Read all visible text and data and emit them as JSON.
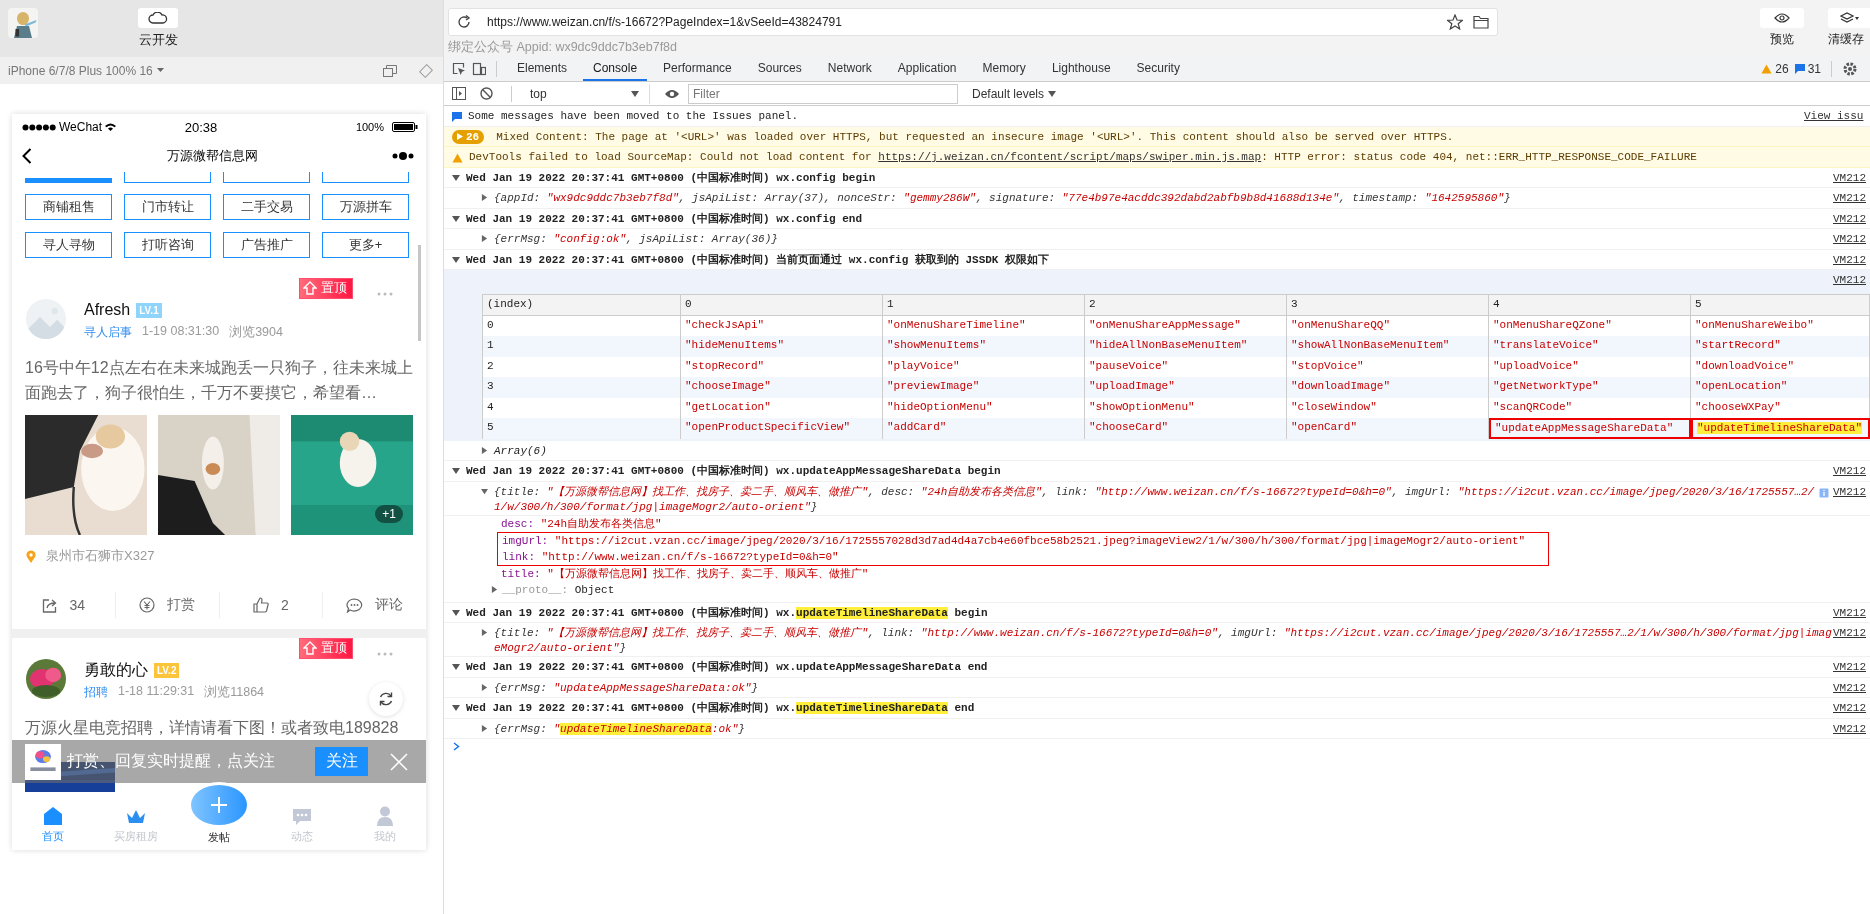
{
  "toolbar": {
    "cloud_button": "云开发",
    "preview_button": "预览",
    "clear_cache_button": "清缓存"
  },
  "address_bar": {
    "url": "https://www.weizan.cn/f/s-16672?PageIndex=1&vSeeId=43824791",
    "appid_label": "绑定公众号 Appid: wx9dc9ddc7b3eb7f8d"
  },
  "simulator": {
    "device": "iPhone 6/7/8 Plus 100% 16",
    "status_bar": {
      "carrier": "WeChat",
      "time": "20:38",
      "battery": "100%"
    },
    "nav_title": "万源微帮信息网",
    "categories": [
      "商铺租售",
      "门市转让",
      "二手交易",
      "万源拼车",
      "寻人寻物",
      "打听咨询",
      "广告推广",
      "更多+"
    ],
    "posts": [
      {
        "author": "Afresh",
        "level": {
          "text": "LV.1",
          "color": "#8fd4fb"
        },
        "category": "寻人启事",
        "time": "1-19 08:31:30",
        "views": "浏览3904",
        "pinned": "置顶",
        "text": "16号中午12点左右在未来城跑丢一只狗子，往未来城上面跑去了，狗子很怕生，千万不要摸它，希望看…",
        "more_images": "+1",
        "location": "泉州市石狮市X327",
        "actions": [
          {
            "kind": "share",
            "label": "34"
          },
          {
            "kind": "reward",
            "label": "打赏"
          },
          {
            "kind": "like",
            "label": "2"
          },
          {
            "kind": "comment",
            "label": "评论"
          }
        ]
      },
      {
        "author": "勇敢的心",
        "level": {
          "text": "LV.2",
          "color": "#fbc43a"
        },
        "category": "招聘",
        "time": "1-18 11:29:31",
        "views": "浏览11864",
        "pinned": "置顶",
        "text": "万源火星电竞招聘，详情请看下图！或者致电189828"
      }
    ],
    "follow_banner": {
      "text": "打赏、回复实时提醒，点关注",
      "button": "关注"
    },
    "tab_bar": [
      {
        "kind": "home",
        "label": "首页",
        "selected": true
      },
      {
        "kind": "crown",
        "label": "买房租房",
        "selected": false
      },
      {
        "kind": "post",
        "label": "发帖",
        "selected": false
      },
      {
        "kind": "chat",
        "label": "动态",
        "selected": false
      },
      {
        "kind": "user",
        "label": "我的",
        "selected": false
      }
    ]
  },
  "devtools": {
    "tabs": [
      {
        "label": "Elements",
        "selected": false
      },
      {
        "label": "Console",
        "selected": true
      },
      {
        "label": "Performance",
        "selected": false
      },
      {
        "label": "Sources",
        "selected": false
      },
      {
        "label": "Network",
        "selected": false
      },
      {
        "label": "Application",
        "selected": false
      },
      {
        "label": "Memory",
        "selected": false
      },
      {
        "label": "Lighthouse",
        "selected": false
      },
      {
        "label": "Security",
        "selected": false
      }
    ],
    "warning_count": "26",
    "message_count": "31",
    "context": "top",
    "filter_placeholder": "Filter",
    "levels": "Default levels",
    "console": [
      {
        "kind": "info",
        "text": "Some messages have been moved to the Issues panel.",
        "link": "View issu"
      },
      {
        "kind": "warning-group",
        "count": "26",
        "text": "Mixed Content: The page at '<URL>' was loaded over HTTPS, but requested an insecure image '<URL>'. This content should also be served over HTTPS."
      },
      {
        "kind": "warning",
        "text": "DevTools failed to load SourceMap: Could not load content for ",
        "link": "https://j.weizan.cn/fcontent/script/maps/swiper.min.js.map",
        "after": ": HTTP error: status code 404, net::ERR_HTTP_RESPONSE_CODE_FAILURE"
      },
      {
        "kind": "group",
        "expanded": true,
        "source": "VM212",
        "tokens": [
          {
            "text": "Wed Jan 19 2022 20:37:41 GMT+0800 (中国标准时间) wx.config begin",
            "kind": "plain"
          }
        ]
      },
      {
        "kind": "object",
        "expanded": false,
        "source": "VM212",
        "tokens": [
          {
            "text": "{appId: ",
            "kind": "key"
          },
          {
            "text": "\"wx9dc9ddc7b3eb7f8d\"",
            "kind": "string"
          },
          {
            "text": ", jsApiList: Array(37), nonceStr: ",
            "kind": "key"
          },
          {
            "text": "\"gemmy286W\"",
            "kind": "string"
          },
          {
            "text": ", signature: ",
            "kind": "key"
          },
          {
            "text": "\"77e4b97e4acddc392dabd2abfb9b8d41688d134e\"",
            "kind": "string"
          },
          {
            "text": ", timestamp: ",
            "kind": "key"
          },
          {
            "text": "\"1642595860\"",
            "kind": "string"
          },
          {
            "text": "}",
            "kind": "key"
          }
        ]
      },
      {
        "kind": "group",
        "expanded": true,
        "source": "VM212",
        "tokens": [
          {
            "text": "Wed Jan 19 2022 20:37:41 GMT+0800 (中国标准时间) wx.config end",
            "kind": "plain"
          }
        ]
      },
      {
        "kind": "object",
        "expanded": false,
        "source": "VM212",
        "tokens": [
          {
            "text": "{errMsg: ",
            "kind": "key"
          },
          {
            "text": "\"config:ok\"",
            "kind": "string"
          },
          {
            "text": ", jsApiList: Array(36)}",
            "kind": "key"
          }
        ]
      },
      {
        "kind": "group",
        "expanded": true,
        "source": "VM212",
        "tokens": [
          {
            "text": "Wed Jan 19 2022 20:37:41 GMT+0800 (中国标准时间) 当前页面通过 wx.config 获取到的 JSSDK 权限如下",
            "kind": "plain"
          }
        ]
      },
      {
        "kind": "table",
        "source": "VM212",
        "columns": [
          "(index)",
          "0",
          "1",
          "2",
          "3",
          "4",
          "5"
        ],
        "rows": [
          {
            "cells": [
              {
                "text": "0",
                "boxed": false,
                "highlighted": false
              },
              {
                "text": "\"checkJsApi\"",
                "boxed": false,
                "highlighted": false
              },
              {
                "text": "\"onMenuShareTimeline\"",
                "boxed": false,
                "highlighted": false
              },
              {
                "text": "\"onMenuShareAppMessage\"",
                "boxed": false,
                "highlighted": false
              },
              {
                "text": "\"onMenuShareQQ\"",
                "boxed": false,
                "highlighted": false
              },
              {
                "text": "\"onMenuShareQZone\"",
                "boxed": false,
                "highlighted": false
              },
              {
                "text": "\"onMenuShareWeibo\"",
                "boxed": false,
                "highlighted": false
              }
            ]
          },
          {
            "cells": [
              {
                "text": "1",
                "boxed": false,
                "highlighted": false
              },
              {
                "text": "\"hideMenuItems\"",
                "boxed": false,
                "highlighted": false
              },
              {
                "text": "\"showMenuItems\"",
                "boxed": false,
                "highlighted": false
              },
              {
                "text": "\"hideAllNonBaseMenuItem\"",
                "boxed": false,
                "highlighted": false
              },
              {
                "text": "\"showAllNonBaseMenuItem\"",
                "boxed": false,
                "highlighted": false
              },
              {
                "text": "\"translateVoice\"",
                "boxed": false,
                "highlighted": false
              },
              {
                "text": "\"startRecord\"",
                "boxed": false,
                "highlighted": false
              }
            ]
          },
          {
            "cells": [
              {
                "text": "2",
                "boxed": false,
                "highlighted": false
              },
              {
                "text": "\"stopRecord\"",
                "boxed": false,
                "highlighted": false
              },
              {
                "text": "\"playVoice\"",
                "boxed": false,
                "highlighted": false
              },
              {
                "text": "\"pauseVoice\"",
                "boxed": false,
                "highlighted": false
              },
              {
                "text": "\"stopVoice\"",
                "boxed": false,
                "highlighted": false
              },
              {
                "text": "\"uploadVoice\"",
                "boxed": false,
                "highlighted": false
              },
              {
                "text": "\"downloadVoice\"",
                "boxed": false,
                "highlighted": false
              }
            ]
          },
          {
            "cells": [
              {
                "text": "3",
                "boxed": false,
                "highlighted": false
              },
              {
                "text": "\"chooseImage\"",
                "boxed": false,
                "highlighted": false
              },
              {
                "text": "\"previewImage\"",
                "boxed": false,
                "highlighted": false
              },
              {
                "text": "\"uploadImage\"",
                "boxed": false,
                "highlighted": false
              },
              {
                "text": "\"downloadImage\"",
                "boxed": false,
                "highlighted": false
              },
              {
                "text": "\"getNetworkType\"",
                "boxed": false,
                "highlighted": false
              },
              {
                "text": "\"openLocation\"",
                "boxed": false,
                "highlighted": false
              }
            ]
          },
          {
            "cells": [
              {
                "text": "4",
                "boxed": false,
                "highlighted": false
              },
              {
                "text": "\"getLocation\"",
                "boxed": false,
                "highlighted": false
              },
              {
                "text": "\"hideOptionMenu\"",
                "boxed": false,
                "highlighted": false
              },
              {
                "text": "\"showOptionMenu\"",
                "boxed": false,
                "highlighted": false
              },
              {
                "text": "\"closeWindow\"",
                "boxed": false,
                "highlighted": false
              },
              {
                "text": "\"scanQRCode\"",
                "boxed": false,
                "highlighted": false
              },
              {
                "text": "\"chooseWXPay\"",
                "boxed": false,
                "highlighted": false
              }
            ]
          },
          {
            "cells": [
              {
                "text": "5",
                "boxed": false,
                "highlighted": false
              },
              {
                "text": "\"openProductSpecificView\"",
                "boxed": false,
                "highlighted": false
              },
              {
                "text": "\"addCard\"",
                "boxed": false,
                "highlighted": false
              },
              {
                "text": "\"chooseCard\"",
                "boxed": false,
                "highlighted": false
              },
              {
                "text": "\"openCard\"",
                "boxed": false,
                "highlighted": false
              },
              {
                "text": "\"updateAppMessageShareData\"",
                "boxed": true,
                "highlighted": false
              },
              {
                "text": "\"updateTimelineShareData\"",
                "boxed": true,
                "highlighted": true
              }
            ]
          }
        ]
      },
      {
        "kind": "object",
        "expanded": false,
        "tokens": [
          {
            "text": "Array(6)",
            "kind": "plain"
          }
        ]
      },
      {
        "kind": "group",
        "expanded": true,
        "source": "VM212",
        "tokens": [
          {
            "text": "Wed Jan 19 2022 20:37:41 GMT+0800 (中国标准时间) wx.updateAppMessageShareData begin",
            "kind": "plain"
          }
        ]
      },
      {
        "kind": "expanded-object",
        "expanded": true,
        "source": "VM212",
        "tokens": [
          {
            "text": "{title: ",
            "kind": "key"
          },
          {
            "text": "\"【万源微帮信息网】找工作、找房子、卖二手、顺风车、做推广\"",
            "kind": "string"
          },
          {
            "text": ", desc: ",
            "kind": "key"
          },
          {
            "text": "\"24h自助发布各类信息\"",
            "kind": "string"
          },
          {
            "text": ", link: ",
            "kind": "key"
          },
          {
            "text": "\"http://www.weizan.cn/f/s-16672?typeId=0&h=0\"",
            "kind": "string"
          },
          {
            "text": ", imgUrl: ",
            "kind": "key"
          },
          {
            "text": "\"https://i2cut.vzan.cc/image/jpeg/2020/3/16/1725557…2/1/w/300/h/300/format/jpg|imageMogr2/auto-orient\"",
            "kind": "string"
          },
          {
            "text": "}",
            "kind": "key"
          }
        ],
        "properties": [
          {
            "key": "desc:",
            "value": "\"24h自助发布各类信息\"",
            "kind": "string",
            "boxed": false,
            "expandable": false
          },
          {
            "key": "imgUrl:",
            "value": "\"https://i2cut.vzan.cc/image/jpeg/2020/3/16/1725557028d3d7ad4d4a7cb4e60fbce58b2521.jpeg?imageView2/1/w/300/h/300/format/jpg|imageMogr2/auto-orient\"",
            "kind": "string",
            "boxed": true,
            "expandable": false
          },
          {
            "key": "link:",
            "value": "\"http://www.weizan.cn/f/s-16672?typeId=0&h=0\"",
            "kind": "string",
            "boxed": true,
            "expandable": false
          },
          {
            "key": "title:",
            "value": "\"【万源微帮信息网】找工作、找房子、卖二手、顺风车、做推广\"",
            "kind": "string",
            "boxed": false,
            "expandable": false
          },
          {
            "key": "__proto__:",
            "value": "Object",
            "kind": "plain",
            "boxed": false,
            "expandable": true
          }
        ]
      },
      {
        "kind": "group",
        "expanded": true,
        "source": "VM212",
        "tokens": [
          {
            "text": "Wed Jan 19 2022 20:37:41 GMT+0800 (中国标准时间) wx.",
            "kind": "plain"
          },
          {
            "text": "updateTimelineShareData",
            "kind": "mark"
          },
          {
            "text": " begin",
            "kind": "plain"
          }
        ]
      },
      {
        "kind": "object",
        "expanded": false,
        "source": "VM212",
        "tokens": [
          {
            "text": "{title: ",
            "kind": "key"
          },
          {
            "text": "\"【万源微帮信息网】找工作、找房子、卖二手、顺风车、做推广\"",
            "kind": "string"
          },
          {
            "text": ", link: ",
            "kind": "key"
          },
          {
            "text": "\"http://www.weizan.cn/f/s-16672?typeId=0&h=0\"",
            "kind": "string"
          },
          {
            "text": ", imgUrl: ",
            "kind": "key"
          },
          {
            "text": "\"https://i2cut.vzan.cc/image/jpeg/2020/3/16/1725557…2/1/w/300/h/300/format/jpg|imageMogr2/auto-orient\"",
            "kind": "string"
          },
          {
            "text": "}",
            "kind": "key"
          }
        ]
      },
      {
        "kind": "group",
        "expanded": true,
        "source": "VM212",
        "tokens": [
          {
            "text": "Wed Jan 19 2022 20:37:41 GMT+0800 (中国标准时间) wx.updateAppMessageShareData end",
            "kind": "plain"
          }
        ]
      },
      {
        "kind": "object",
        "expanded": false,
        "source": "VM212",
        "tokens": [
          {
            "text": "{errMsg: ",
            "kind": "key"
          },
          {
            "text": "\"updateAppMessageShareData:ok\"",
            "kind": "string"
          },
          {
            "text": "}",
            "kind": "key"
          }
        ]
      },
      {
        "kind": "group",
        "expanded": true,
        "source": "VM212",
        "tokens": [
          {
            "text": "Wed Jan 19 2022 20:37:41 GMT+0800 (中国标准时间) wx.",
            "kind": "plain"
          },
          {
            "text": "updateTimelineShareData",
            "kind": "mark"
          },
          {
            "text": " end",
            "kind": "plain"
          }
        ]
      },
      {
        "kind": "object",
        "expanded": false,
        "source": "VM212",
        "tokens": [
          {
            "text": "{errMsg: ",
            "kind": "key"
          },
          {
            "text": "\"",
            "kind": "string"
          },
          {
            "text": "updateTimelineShareData",
            "kind": "string-mark"
          },
          {
            "text": ":ok\"",
            "kind": "string"
          },
          {
            "text": "}",
            "kind": "key"
          }
        ]
      },
      {
        "kind": "prompt"
      }
    ]
  }
}
